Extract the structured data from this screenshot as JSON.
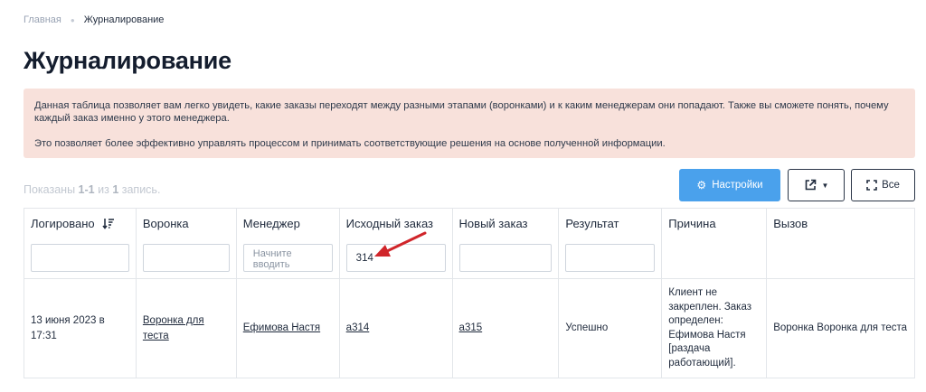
{
  "breadcrumb": {
    "home": "Главная",
    "current": "Журналирование"
  },
  "page_title": "Журналирование",
  "alert": {
    "line1": "Данная таблица позволяет вам легко увидеть, какие заказы переходят между разными этапами (воронками) и к каким менеджерам они попадают. Также вы сможете понять, почему каждый заказ именно у этого менеджера.",
    "line2": "Это позволяет более эффективно управлять процессом и принимать соответствующие решения на основе полученной информации."
  },
  "summary": {
    "prefix": "Показаны",
    "range": "1-1",
    "of": "из",
    "total": "1",
    "suffix": "запись."
  },
  "toolbar": {
    "settings_label": "Настройки",
    "all_label": "Все"
  },
  "table": {
    "columns": [
      {
        "label": "Логировано"
      },
      {
        "label": "Воронка"
      },
      {
        "label": "Менеджер",
        "placeholder": "Начните вводить"
      },
      {
        "label": "Исходный заказ",
        "value": "314"
      },
      {
        "label": "Новый заказ"
      },
      {
        "label": "Результат"
      },
      {
        "label": "Причина"
      },
      {
        "label": "Вызов"
      }
    ],
    "rows": [
      {
        "logged": "13 июня 2023 в 17:31",
        "funnel": "Воронка для теста",
        "manager": "Ефимова Настя",
        "source_order": "a314",
        "new_order": "a315",
        "result": "Успешно",
        "reason": "Клиент не закреплен. Заказ определен: Ефимова Настя [раздача работающий].",
        "call": "Воронка Воронка для теста"
      }
    ]
  },
  "colors": {
    "primary": "#4aa1ec",
    "alert_bg": "#f8e1db",
    "annotation": "#d0252a"
  },
  "icons": {
    "settings": "gear-icon",
    "export": "external-link-icon",
    "all": "expand-icon",
    "sort": "sort-descending-icon"
  }
}
